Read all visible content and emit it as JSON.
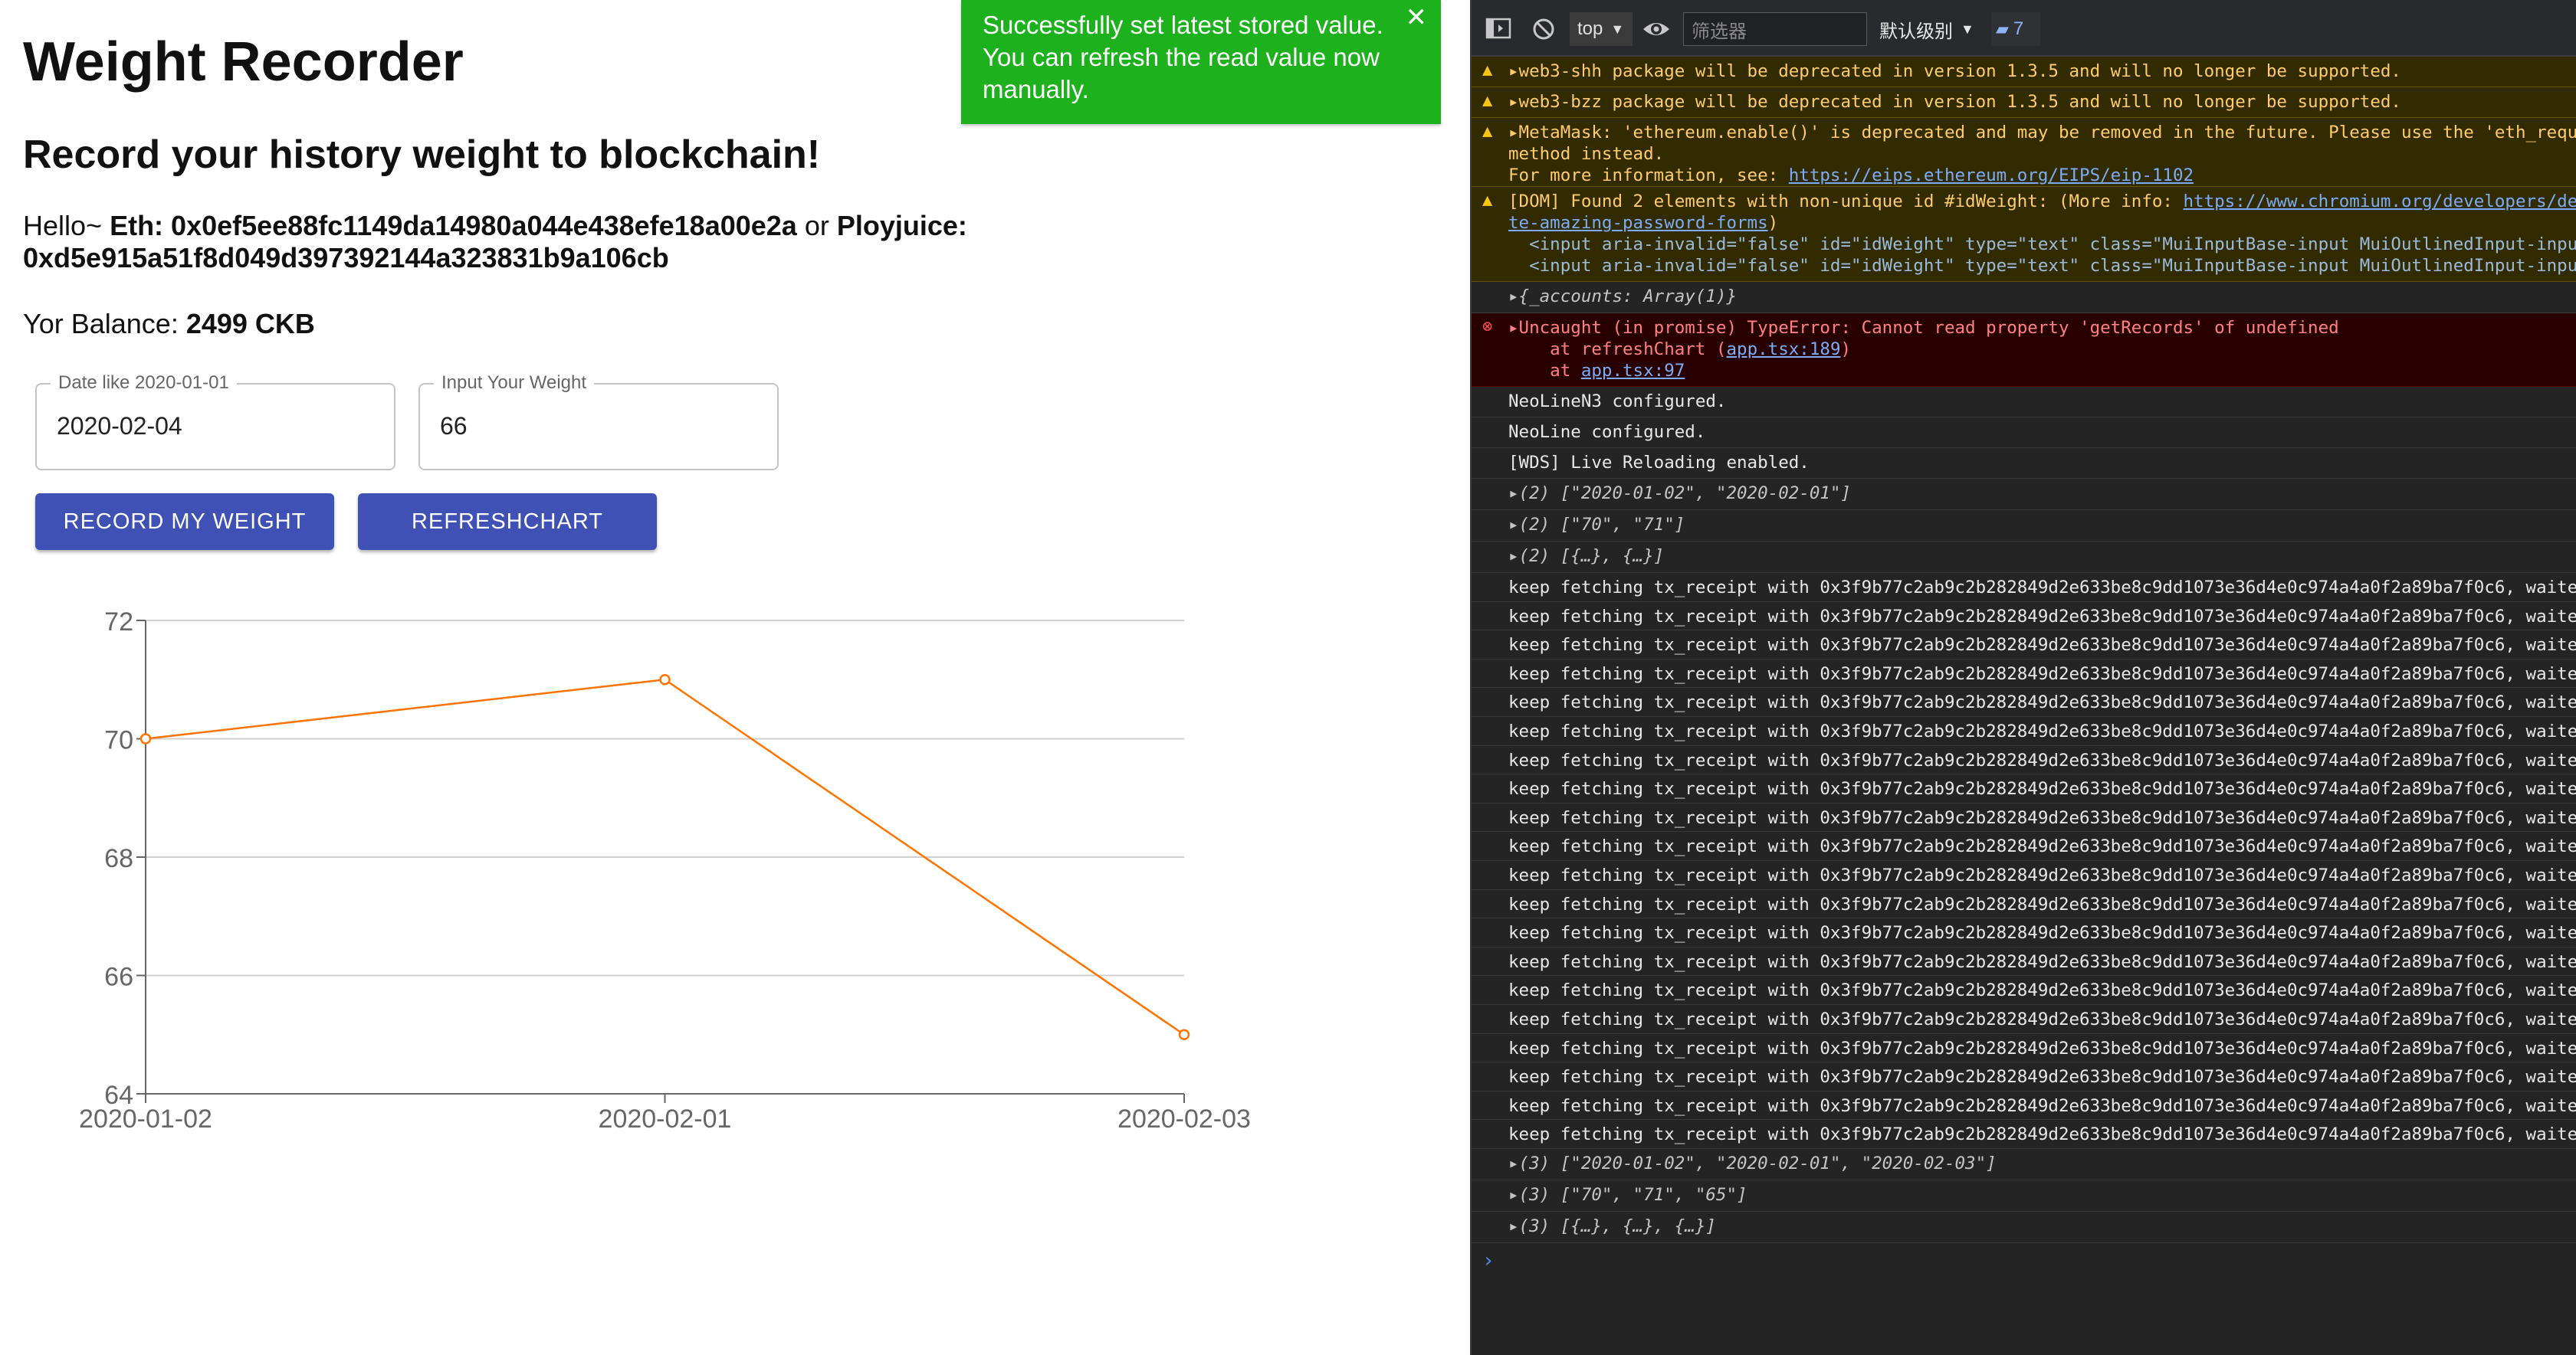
{
  "app": {
    "title": "Weight Recorder",
    "subtitle": "Record your history weight to blockchain!",
    "hello_prefix": "Hello~ ",
    "eth_label": "Eth: 0x0ef5ee88fc1149da14980a044e438efe18a00e2a",
    "or_text": " or ",
    "polyjuice_label": "Ployjuice: 0xd5e915a51f8d049d397392144a323831b9a106cb",
    "balance_prefix": "Yor Balance: ",
    "balance_value": "2499 CKB",
    "date_field": {
      "label": "Date like 2020-01-01",
      "value": "2020-02-04"
    },
    "weight_field": {
      "label": "Input Your Weight",
      "value": "66"
    },
    "record_button": "RECORD MY WEIGHT",
    "refresh_button": "REFRESHCHART",
    "toast": {
      "message": "Successfully set latest stored value. You can refresh the read value now manually.",
      "close_icon": "close-icon"
    }
  },
  "chart_data": {
    "type": "line",
    "categories": [
      "2020-01-02",
      "2020-02-01",
      "2020-02-03"
    ],
    "values": [
      70,
      71,
      65
    ],
    "ylim": [
      64,
      72
    ],
    "yticks": [
      64,
      66,
      68,
      70,
      72
    ],
    "grid": true,
    "color": "#ff7300"
  },
  "devtools": {
    "toolbar": {
      "context": "top",
      "filter_placeholder": "筛选器",
      "level": "默认级别",
      "message_count": "7"
    },
    "logs": [
      {
        "kind": "warn",
        "text": "▸web3-shh package will be deprecated in version 1.3.5 and will no longer be supported."
      },
      {
        "kind": "warn",
        "text": "▸web3-bzz package will be deprecated in version 1.3.5 and will no longer be supported."
      },
      {
        "kind": "warn",
        "text": "▸MetaMask: 'ethereum.enable()' is deprecated and may be removed in the future. Please use the 'eth_reques",
        "line2": "method instead.",
        "line3_prefix": "For more information, see: ",
        "line3_link": "https://eips.ethereum.org/EIPS/eip-1102"
      },
      {
        "kind": "warn",
        "text": "[DOM] Found 2 elements with non-unique id #idWeight: (More info: ",
        "link": "https://www.chromium.org/developers/desig",
        "line2_link": "te-amazing-password-forms",
        "line2_suffix": ")",
        "line3": "  <input aria-invalid=\"false\" id=\"idWeight\" type=\"text\" class=\"MuiInputBase-input MuiOutlinedInput-input\"",
        "line4": "  <input aria-invalid=\"false\" id=\"idWeight\" type=\"text\" class=\"MuiInputBase-input MuiOutlinedInput-input\""
      },
      {
        "kind": "obj",
        "text": "▸{_accounts: Array(1)}"
      },
      {
        "kind": "err",
        "text": "▸Uncaught (in promise) TypeError: Cannot read property 'getRecords' of undefined",
        "line2_prefix": "    at refreshChart (",
        "line2_link": "app.tsx:189",
        "line2_suffix": ")",
        "line3_prefix": "    at ",
        "line3_link": "app.tsx:97"
      },
      {
        "kind": "info",
        "text": "NeoLineN3 configured."
      },
      {
        "kind": "info",
        "text": "NeoLine configured."
      },
      {
        "kind": "info",
        "text": "[WDS] Live Reloading enabled."
      },
      {
        "kind": "obj",
        "text": "▸(2) [\"2020-01-02\", \"2020-02-01\"]"
      },
      {
        "kind": "obj",
        "text": "▸(2) [\"70\", \"71\"]"
      },
      {
        "kind": "obj",
        "text": "▸(2) [{…}, {…}]"
      },
      {
        "kind": "repeat",
        "text": "keep fetching tx_receipt with 0x3f9b77c2ab9c2b282849d2e633be8c9dd1073e36d4e0c974a4a0f2a89ba7f0c6, waited f",
        "count": 20
      },
      {
        "kind": "obj",
        "text": "▸(3) [\"2020-01-02\", \"2020-02-01\", \"2020-02-03\"]"
      },
      {
        "kind": "obj",
        "text": "▸(3) [\"70\", \"71\", \"65\"]"
      },
      {
        "kind": "obj",
        "text": "▸(3) [{…}, {…}, {…}]"
      }
    ],
    "prompt": "›"
  }
}
